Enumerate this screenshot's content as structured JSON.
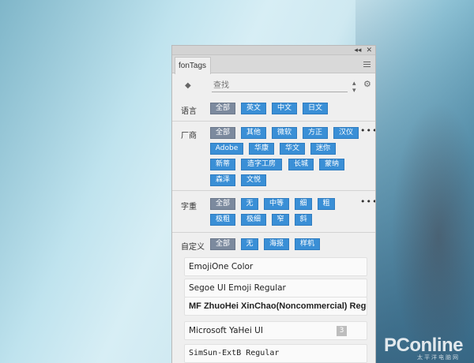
{
  "panel": {
    "title": "fonTags",
    "collapse_glyph": "◂◂",
    "close_glyph": "✕"
  },
  "search": {
    "placeholder": "查找"
  },
  "sections": {
    "language": {
      "label": "语言",
      "chips": [
        "全部",
        "英文",
        "中文",
        "日文"
      ]
    },
    "vendor": {
      "label": "厂商",
      "chips": [
        "全部",
        "其他",
        "微软",
        "方正",
        "汉仪",
        "Adobe",
        "华康",
        "华文",
        "迷你",
        "新蒂",
        "造字工房",
        "长城",
        "蒙纳",
        "森泽",
        "文悦"
      ]
    },
    "weight": {
      "label": "字重",
      "chips": [
        "全部",
        "无",
        "中等",
        "细",
        "粗",
        "极粗",
        "极细",
        "窄",
        "斜"
      ]
    },
    "custom": {
      "label": "自定义",
      "chips": [
        "全部",
        "无",
        "海报",
        "样机"
      ]
    }
  },
  "fonts": [
    {
      "name": "EmojiOne Color"
    },
    {
      "name": "Segoe UI Emoji Regular"
    },
    {
      "name": "MF ZhuoHei XinChao(Noncommercial) Regular"
    },
    {
      "name": "Microsoft YaHei UI",
      "count": "3"
    },
    {
      "name": "SimSun-ExtB Regular"
    }
  ],
  "watermark": {
    "brand": "PConline",
    "sub": "太平洋电脑网"
  }
}
